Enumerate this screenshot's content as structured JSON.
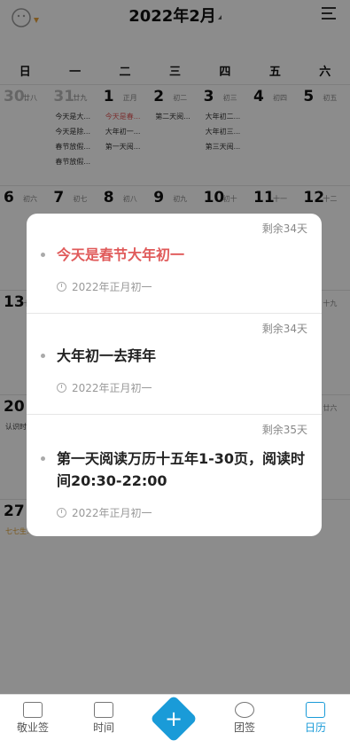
{
  "header": {
    "month_title": "2022年2月"
  },
  "weekdays": [
    "日",
    "一",
    "二",
    "三",
    "四",
    "五",
    "六"
  ],
  "calendar": {
    "weeks": [
      {
        "days": [
          {
            "num": "30",
            "lunar": "廿八",
            "dim": true,
            "events": []
          },
          {
            "num": "31",
            "lunar": "廿九",
            "dim": true,
            "events": [
              "今天是大...",
              "今天是除...",
              "春节放假...",
              "春节放假..."
            ]
          },
          {
            "num": "1",
            "lunar": "正月",
            "dim": false,
            "events": [
              "今天是春...",
              "大年初一...",
              "第一天阅..."
            ],
            "red_first": true
          },
          {
            "num": "2",
            "lunar": "初二",
            "dim": false,
            "events": [
              "第二天阅..."
            ]
          },
          {
            "num": "3",
            "lunar": "初三",
            "dim": false,
            "events": [
              "大年初二...",
              "大年初三...",
              "第三天阅..."
            ]
          },
          {
            "num": "4",
            "lunar": "初四",
            "dim": false,
            "events": []
          },
          {
            "num": "5",
            "lunar": "初五",
            "dim": false,
            "events": []
          }
        ]
      },
      {
        "days": [
          {
            "num": "6",
            "lunar": "初六",
            "dim": false,
            "events": []
          },
          {
            "num": "7",
            "lunar": "初七",
            "dim": false,
            "events": []
          },
          {
            "num": "8",
            "lunar": "初八",
            "dim": false,
            "events": []
          },
          {
            "num": "9",
            "lunar": "初九",
            "dim": false,
            "events": []
          },
          {
            "num": "10",
            "lunar": "初十",
            "dim": false,
            "events": []
          },
          {
            "num": "11",
            "lunar": "十一",
            "dim": false,
            "events": []
          },
          {
            "num": "12",
            "lunar": "十二",
            "dim": false,
            "events": []
          }
        ]
      },
      {
        "days": [
          {
            "num": "13",
            "lunar": "十三",
            "dim": false,
            "events": []
          },
          {
            "num": "",
            "lunar": "",
            "dim": false,
            "events": []
          },
          {
            "num": "",
            "lunar": "",
            "dim": false,
            "events": []
          },
          {
            "num": "",
            "lunar": "",
            "dim": false,
            "events": []
          },
          {
            "num": "",
            "lunar": "",
            "dim": false,
            "events": []
          },
          {
            "num": "",
            "lunar": "",
            "dim": false,
            "events": []
          },
          {
            "num": "",
            "lunar": "十九",
            "dim": false,
            "events": []
          }
        ]
      },
      {
        "days": [
          {
            "num": "20",
            "lunar": "",
            "dim": false,
            "events": [
              "认识时..."
            ]
          },
          {
            "num": "",
            "lunar": "",
            "dim": false,
            "events": []
          },
          {
            "num": "",
            "lunar": "",
            "dim": false,
            "events": []
          },
          {
            "num": "",
            "lunar": "",
            "dim": false,
            "events": []
          },
          {
            "num": "",
            "lunar": "",
            "dim": false,
            "events": []
          },
          {
            "num": "",
            "lunar": "",
            "dim": false,
            "events": []
          },
          {
            "num": "",
            "lunar": "廿六",
            "dim": false,
            "events": []
          }
        ]
      },
      {
        "days": [
          {
            "num": "27",
            "lunar": "",
            "dim": false,
            "events": [
              "七七生..."
            ],
            "orange_first": true
          },
          {
            "num": "",
            "lunar": "",
            "dim": false,
            "events": [
              "2022..."
            ]
          },
          {
            "num": "",
            "lunar": "",
            "dim": false,
            "events": []
          },
          {
            "num": "",
            "lunar": "",
            "dim": false,
            "events": []
          },
          {
            "num": "",
            "lunar": "",
            "dim": false,
            "events": []
          },
          {
            "num": "",
            "lunar": "",
            "dim": false,
            "events": []
          },
          {
            "num": "",
            "lunar": "",
            "dim": false,
            "events": []
          }
        ]
      }
    ]
  },
  "modal": {
    "items": [
      {
        "remaining": "剩余34天",
        "title": "今天是春节大年初一",
        "date": "2022年正月初一",
        "highlight": true
      },
      {
        "remaining": "剩余34天",
        "title": "大年初一去拜年",
        "date": "2022年正月初一",
        "highlight": false
      },
      {
        "remaining": "剩余35天",
        "title": "第一天阅读万历十五年1-30页，阅读时间20:30-22:00",
        "date": "2022年正月初一",
        "highlight": false
      }
    ]
  },
  "tabbar": {
    "tabs": [
      {
        "label": "敬业签",
        "icon": "shoe-icon",
        "active": false
      },
      {
        "label": "时间",
        "icon": "calendar-clock-icon",
        "active": false
      },
      {
        "label": "团签",
        "icon": "team-icon",
        "active": false
      },
      {
        "label": "日历",
        "icon": "calendar-icon",
        "active": true
      }
    ],
    "add_symbol": "+"
  }
}
